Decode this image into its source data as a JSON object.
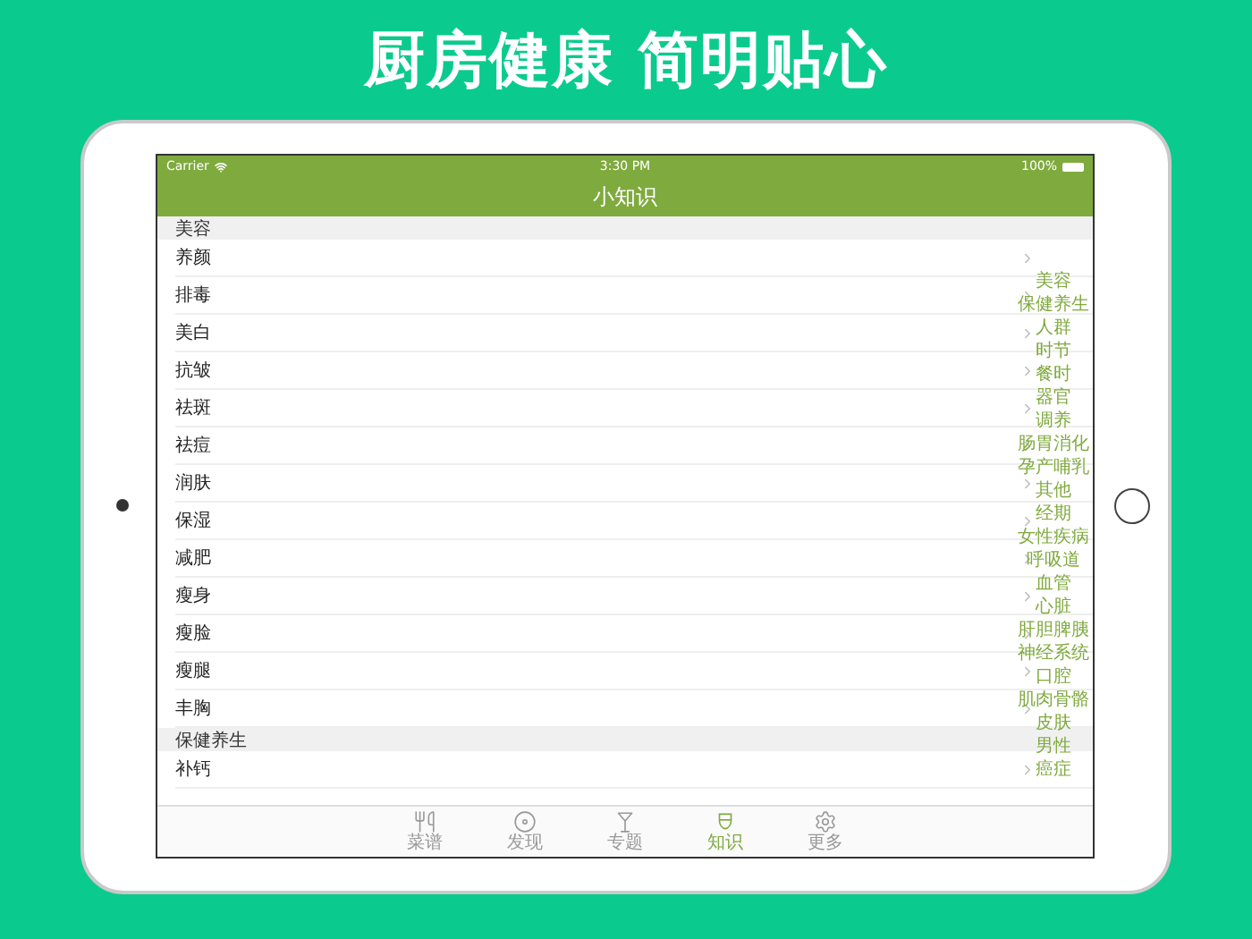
{
  "headline": "厨房健康 简明贴心",
  "status_bar": {
    "carrier": "Carrier",
    "time": "3:30 PM",
    "battery": "100%"
  },
  "nav": {
    "title": "小知识"
  },
  "sections": [
    {
      "title": "美容",
      "rows": [
        "养颜",
        "排毒",
        "美白",
        "抗皱",
        "祛斑",
        "祛痘",
        "润肤",
        "保湿",
        "减肥",
        "瘦身",
        "瘦脸",
        "瘦腿",
        "丰胸"
      ]
    },
    {
      "title": "保健养生",
      "rows": [
        "补钙"
      ]
    }
  ],
  "index": [
    "美容",
    "保健养生",
    "人群",
    "时节",
    "餐时",
    "器官",
    "调养",
    "肠胃消化",
    "孕产哺乳",
    "其他",
    "经期",
    "女性疾病",
    "呼吸道",
    "血管",
    "心脏",
    "肝胆脾胰",
    "神经系统",
    "口腔",
    "肌肉骨骼",
    "皮肤",
    "男性",
    "癌症"
  ],
  "tabs": [
    {
      "label": "菜谱",
      "kind": "cutlery",
      "selected": false
    },
    {
      "label": "发现",
      "kind": "disc",
      "selected": false
    },
    {
      "label": "专题",
      "kind": "cocktail",
      "selected": false
    },
    {
      "label": "知识",
      "kind": "chef",
      "selected": true
    },
    {
      "label": "更多",
      "kind": "gear",
      "selected": false
    }
  ]
}
